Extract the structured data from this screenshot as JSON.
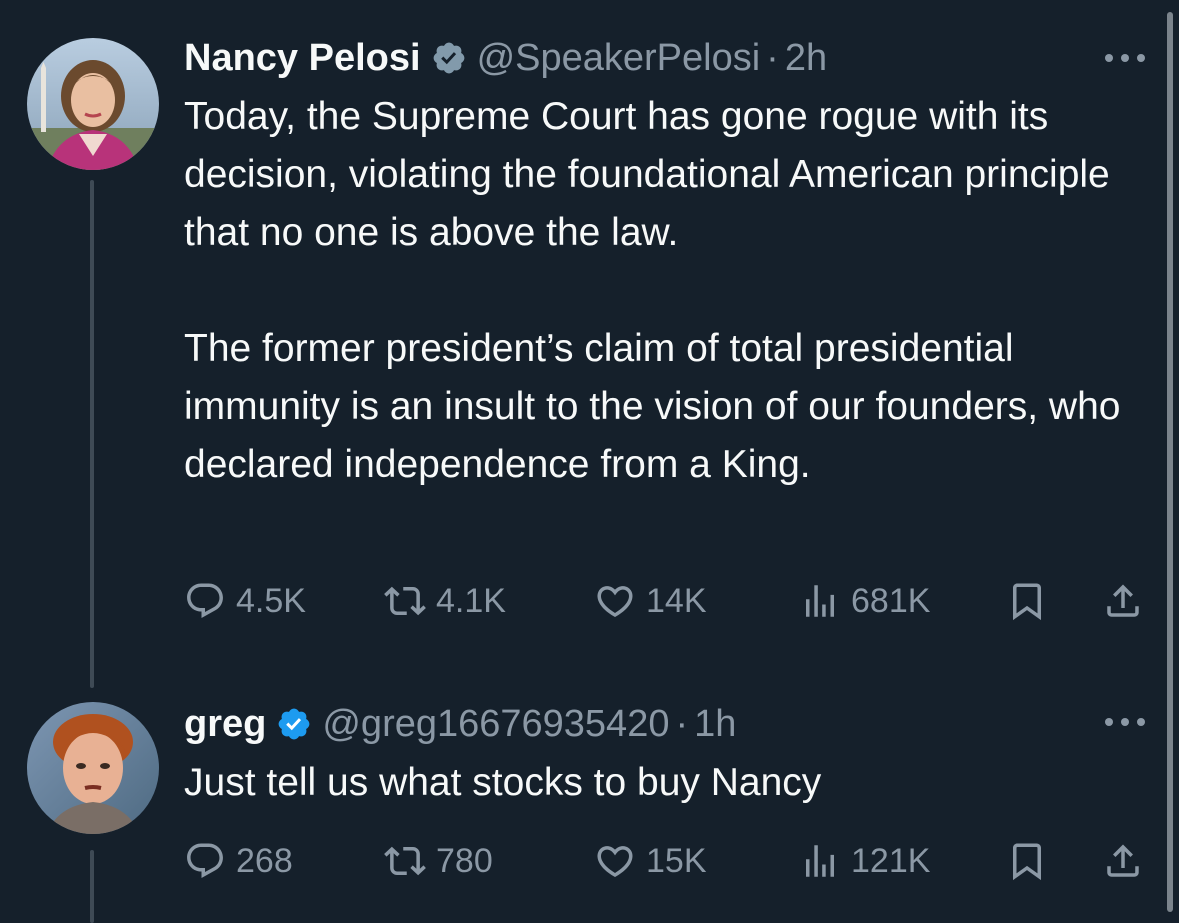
{
  "tweets": [
    {
      "name": "Nancy Pelosi",
      "handle": "@SpeakerPelosi",
      "separator": "·",
      "time": "2h",
      "text": "Today, the Supreme Court has gone rogue with its decision, violating the foundational American principle that no one is above the law.\n\nThe former president’s claim of total presidential immunity is an insult to the vision of our founders, who declared independence from a King.",
      "replies": "4.5K",
      "retweets": "4.1K",
      "likes": "14K",
      "views": "681K",
      "verified_color": "#829aab"
    },
    {
      "name": "greg",
      "handle": "@greg16676935420",
      "separator": "·",
      "time": "1h",
      "text": "Just tell us what stocks to buy Nancy",
      "replies": "268",
      "retweets": "780",
      "likes": "15K",
      "views": "121K",
      "verified_color": "#1d9bf0"
    }
  ],
  "icons": [
    "reply-icon",
    "retweet-icon",
    "like-icon",
    "views-icon",
    "bookmark-icon",
    "share-icon",
    "more-icon",
    "verified-badge-icon"
  ],
  "colors": {
    "background": "#15202b",
    "text": "#f7f9f9",
    "secondary": "#8b98a5",
    "thread_line": "#3e4a55"
  }
}
